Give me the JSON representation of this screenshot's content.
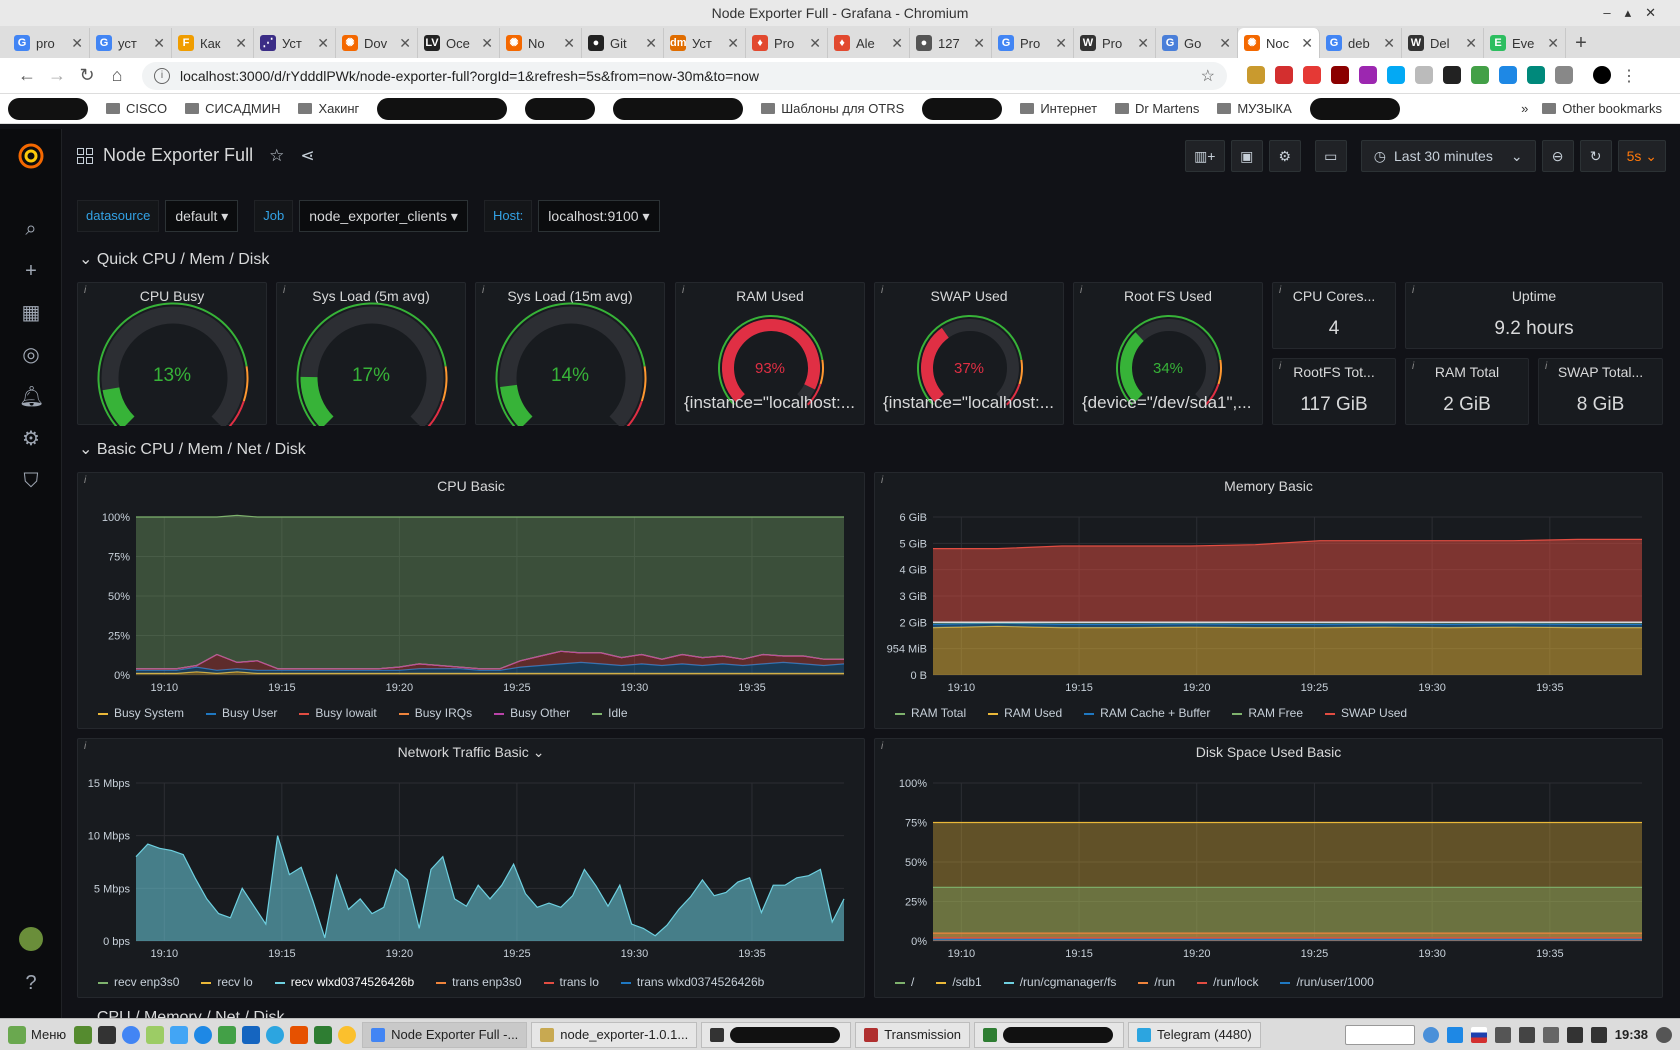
{
  "window": {
    "title": "Node Exporter Full - Grafana - Chromium"
  },
  "tabs": [
    {
      "label": "pro",
      "color": "#4285f4",
      "glyph": "G"
    },
    {
      "label": "уст",
      "color": "#4285f4",
      "glyph": "G"
    },
    {
      "label": "Как",
      "color": "#f09d00",
      "glyph": "F"
    },
    {
      "label": "Уст",
      "color": "#3b2d86",
      "glyph": "⋰"
    },
    {
      "label": "Dov",
      "color": "#f46800",
      "glyph": "✺"
    },
    {
      "label": "Осе",
      "color": "#222222",
      "glyph": "LV"
    },
    {
      "label": "No",
      "color": "#f46800",
      "glyph": "✺"
    },
    {
      "label": "Git",
      "color": "#222222",
      "glyph": "●"
    },
    {
      "label": "Уст",
      "color": "#e06d00",
      "glyph": "dm"
    },
    {
      "label": "Pro",
      "color": "#e2492f",
      "glyph": "♦"
    },
    {
      "label": "Ale",
      "color": "#e2492f",
      "glyph": "♦"
    },
    {
      "label": "127",
      "color": "#555555",
      "glyph": "●"
    },
    {
      "label": "Pro",
      "color": "#4285f4",
      "glyph": "G"
    },
    {
      "label": "Pro",
      "color": "#333333",
      "glyph": "W"
    },
    {
      "label": "Go",
      "color": "#4a7fd9",
      "glyph": "G"
    },
    {
      "label": "Noc",
      "color": "#f46800",
      "glyph": "✺",
      "active": true
    },
    {
      "label": "deb",
      "color": "#4285f4",
      "glyph": "G"
    },
    {
      "label": "Del",
      "color": "#333333",
      "glyph": "W"
    },
    {
      "label": "Eve",
      "color": "#2dbe60",
      "glyph": "E"
    }
  ],
  "address": {
    "url": "localhost:3000/d/rYdddlPWk/node-exporter-full?orgId=1&refresh=5s&from=now-30m&to=now"
  },
  "bookmarks": [
    {
      "label": "CISCO",
      "type": "folder"
    },
    {
      "label": "СИСАДМИН",
      "type": "folder"
    },
    {
      "label": "Хакинг",
      "type": "folder"
    },
    {
      "label": "Шаблоны для OTRS",
      "type": "folder"
    },
    {
      "label": "Интернет",
      "type": "folder"
    },
    {
      "label": "Dr Martens",
      "type": "folder"
    },
    {
      "label": "МУЗЫКА",
      "type": "folder"
    },
    {
      "label": "Other bookmarks",
      "type": "folder"
    }
  ],
  "dashboard": {
    "title": "Node Exporter Full",
    "time_range": "Last 30 minutes",
    "refresh": "5s",
    "vars": [
      {
        "label": "datasource",
        "value": "default"
      },
      {
        "label": "Job",
        "value": "node_exporter_clients"
      },
      {
        "label": "Host:",
        "value": "localhost:9100"
      }
    ],
    "rows": [
      "Quick CPU / Mem / Disk",
      "Basic CPU / Mem / Net / Disk",
      "CPU / Memory / Net / Disk"
    ],
    "gauges": [
      {
        "title": "CPU Busy",
        "value": "13%",
        "fraction": 0.13,
        "color": "#37b338",
        "sub": ""
      },
      {
        "title": "Sys Load (5m avg)",
        "value": "17%",
        "fraction": 0.17,
        "color": "#37b338",
        "sub": ""
      },
      {
        "title": "Sys Load (15m avg)",
        "value": "14%",
        "fraction": 0.14,
        "color": "#37b338",
        "sub": ""
      },
      {
        "title": "RAM Used",
        "value": "93%",
        "fraction": 0.93,
        "color": "#e02f44",
        "sub": "{instance=\"localhost:..."
      },
      {
        "title": "SWAP Used",
        "value": "37%",
        "fraction": 0.37,
        "color": "#e02f44",
        "sub": "{instance=\"localhost:..."
      },
      {
        "title": "Root FS Used",
        "value": "34%",
        "fraction": 0.34,
        "color": "#37b338",
        "sub": "{device=\"/dev/sda1\",..."
      }
    ],
    "stats": [
      {
        "title": "CPU Cores...",
        "value": "4"
      },
      {
        "title": "Uptime",
        "value": "9.2 hours"
      },
      {
        "title": "RootFS Tot...",
        "value": "117 GiB"
      },
      {
        "title": "RAM Total",
        "value": "2 GiB"
      },
      {
        "title": "SWAP Total...",
        "value": "8 GiB"
      }
    ]
  },
  "chart_data": [
    {
      "type": "area",
      "title": "CPU Basic",
      "x": [
        "19:10",
        "19:15",
        "19:20",
        "19:25",
        "19:30",
        "19:35"
      ],
      "y_ticks": [
        "0%",
        "25%",
        "50%",
        "75%",
        "100%"
      ],
      "ylim": [
        0,
        100
      ],
      "series": [
        {
          "name": "Busy System",
          "color": "#eab839",
          "values": [
            1,
            1,
            1,
            2,
            1,
            2,
            1,
            1,
            1,
            1,
            1,
            1,
            1,
            1,
            1,
            1,
            1,
            1,
            1,
            1,
            1,
            1,
            1,
            1,
            1,
            1,
            1,
            1,
            1,
            1,
            1,
            1,
            1,
            1,
            1,
            1
          ]
        },
        {
          "name": "Busy User",
          "color": "#1f78c1",
          "values": [
            2,
            2,
            2,
            3,
            2,
            2,
            2,
            2,
            2,
            2,
            2,
            2,
            2,
            2,
            3,
            3,
            3,
            2,
            2,
            4,
            5,
            6,
            7,
            6,
            5,
            6,
            5,
            6,
            5,
            6,
            5,
            6,
            7,
            6,
            5,
            6
          ]
        },
        {
          "name": "Busy Iowait",
          "color": "#e24d42",
          "values": [
            1,
            1,
            1,
            1,
            10,
            4,
            6,
            1,
            1,
            1,
            1,
            1,
            1,
            2,
            3,
            2,
            1,
            1,
            1,
            4,
            6,
            8,
            6,
            7,
            5,
            6,
            4,
            6,
            5,
            5,
            4,
            6,
            4,
            5,
            4,
            3
          ]
        },
        {
          "name": "Busy IRQs",
          "color": "#ef843c",
          "values": [
            0,
            0,
            0,
            0,
            0,
            0,
            0,
            0,
            0,
            0,
            0,
            0,
            0,
            0,
            0,
            0,
            0,
            0,
            0,
            0,
            0,
            0,
            0,
            0,
            0,
            0,
            0,
            0,
            0,
            0,
            0,
            0,
            0,
            0,
            0,
            0
          ]
        },
        {
          "name": "Busy Other",
          "color": "#ba43a9",
          "values": [
            0,
            0,
            0,
            0,
            0,
            0,
            0,
            0,
            0,
            0,
            0,
            0,
            0,
            0,
            0,
            0,
            0,
            0,
            0,
            0,
            0,
            0,
            0,
            0,
            0,
            0,
            0,
            0,
            0,
            0,
            0,
            0,
            0,
            0,
            0,
            0
          ]
        },
        {
          "name": "Idle",
          "color": "#7eb26d",
          "values": [
            96,
            96,
            96,
            94,
            87,
            93,
            91,
            96,
            96,
            96,
            96,
            96,
            96,
            95,
            93,
            94,
            95,
            96,
            96,
            91,
            88,
            85,
            86,
            86,
            89,
            87,
            90,
            87,
            89,
            88,
            90,
            87,
            88,
            88,
            90,
            90
          ]
        }
      ]
    },
    {
      "type": "area",
      "title": "Memory Basic",
      "x": [
        "19:10",
        "19:15",
        "19:20",
        "19:25",
        "19:30",
        "19:35"
      ],
      "y_ticks": [
        "0 B",
        "954 MiB",
        "2 GiB",
        "3 GiB",
        "4 GiB",
        "5 GiB",
        "6 GiB"
      ],
      "ylim": [
        0,
        6
      ],
      "series": [
        {
          "name": "RAM Total",
          "color": "#7eb26d",
          "values": [
            2,
            2,
            2,
            2,
            2,
            2,
            2,
            2,
            2,
            2,
            2,
            2
          ]
        },
        {
          "name": "RAM Used",
          "color": "#eab839",
          "values": [
            1.8,
            1.85,
            1.8,
            1.8,
            1.82,
            1.8,
            1.8,
            1.82,
            1.8,
            1.82,
            1.8,
            1.8
          ]
        },
        {
          "name": "RAM Cache + Buffer",
          "color": "#1f78c1",
          "values": [
            0.1,
            0.1,
            0.1,
            0.1,
            0.1,
            0.1,
            0.1,
            0.1,
            0.1,
            0.1,
            0.1,
            0.1
          ]
        },
        {
          "name": "RAM Free",
          "color": "#7eb26d",
          "values": [
            0.1,
            0.1,
            0.1,
            0.1,
            0.1,
            0.1,
            0.1,
            0.1,
            0.1,
            0.1,
            0.1,
            0.1
          ]
        },
        {
          "name": "SWAP Used",
          "color": "#e24d42",
          "values": [
            4.8,
            4.8,
            4.9,
            4.9,
            4.9,
            4.95,
            5.1,
            5.1,
            5.1,
            5.1,
            5.15,
            5.15
          ]
        }
      ]
    },
    {
      "type": "area",
      "title": "Network Traffic Basic",
      "x": [
        "19:10",
        "19:15",
        "19:20",
        "19:25",
        "19:30",
        "19:35"
      ],
      "y_ticks": [
        "0 bps",
        "5 Mbps",
        "10 Mbps",
        "15 Mbps"
      ],
      "ylim": [
        0,
        15
      ],
      "series": [
        {
          "name": "recv enp3s0",
          "color": "#7eb26d",
          "values": []
        },
        {
          "name": "recv lo",
          "color": "#eab839",
          "values": []
        },
        {
          "name": "recv wlxd0374526426b",
          "color": "#6ed0e0",
          "values": [
            8,
            9.2,
            8.8,
            8.6,
            8.2,
            6,
            4,
            2.6,
            2.2,
            5,
            3.3,
            1.6,
            10,
            6.3,
            7,
            3.8,
            0.3,
            6.2,
            3,
            4,
            2.6,
            3.2,
            6.8,
            5.8,
            1.2,
            6.8,
            8,
            4,
            3.3,
            5.3,
            4,
            5.3,
            7.3,
            4.5,
            3.2,
            3.6,
            3.2,
            4.3,
            6.8,
            5.2,
            3.3,
            5.3,
            1.6,
            1.2,
            0.5,
            1.5,
            3,
            4.2,
            5.8,
            4.3,
            4.6,
            5.6,
            6,
            2.7,
            5.3,
            5.3,
            6,
            6.2,
            6.8,
            1.8,
            4
          ]
        },
        {
          "name": "trans enp3s0",
          "color": "#ef843c",
          "values": []
        },
        {
          "name": "trans lo",
          "color": "#e24d42",
          "values": []
        },
        {
          "name": "trans wlxd0374526426b",
          "color": "#1f78c1",
          "values": []
        }
      ]
    },
    {
      "type": "area",
      "title": "Disk Space Used Basic",
      "x": [
        "19:10",
        "19:15",
        "19:20",
        "19:25",
        "19:30",
        "19:35"
      ],
      "y_ticks": [
        "0%",
        "25%",
        "50%",
        "75%",
        "100%"
      ],
      "ylim": [
        0,
        100
      ],
      "series": [
        {
          "name": "/",
          "color": "#7eb26d",
          "values": [
            34,
            34
          ]
        },
        {
          "name": "/sdb1",
          "color": "#eab839",
          "values": [
            75,
            75
          ]
        },
        {
          "name": "/run/cgmanager/fs",
          "color": "#6ed0e0",
          "values": [
            0,
            0
          ]
        },
        {
          "name": "/run",
          "color": "#ef843c",
          "values": [
            5,
            5
          ]
        },
        {
          "name": "/run/lock",
          "color": "#e24d42",
          "values": [
            2,
            2
          ]
        },
        {
          "name": "/run/user/1000",
          "color": "#1f78c1",
          "values": [
            1,
            1
          ]
        }
      ]
    }
  ],
  "taskbar": {
    "menu": "Меню",
    "windows": [
      {
        "label": "Node Exporter Full -...",
        "color": "#4285f4",
        "active": true
      },
      {
        "label": "node_exporter-1.0.1...",
        "color": "#c8a951"
      },
      {
        "label": "",
        "color": "#333333",
        "redacted": true
      },
      {
        "label": "Transmission",
        "color": "#b03030"
      },
      {
        "label": "",
        "color": "#2e7d32",
        "redacted": true
      },
      {
        "label": "Telegram (4480)",
        "color": "#2ca5e0"
      }
    ],
    "clock": "19:38"
  }
}
